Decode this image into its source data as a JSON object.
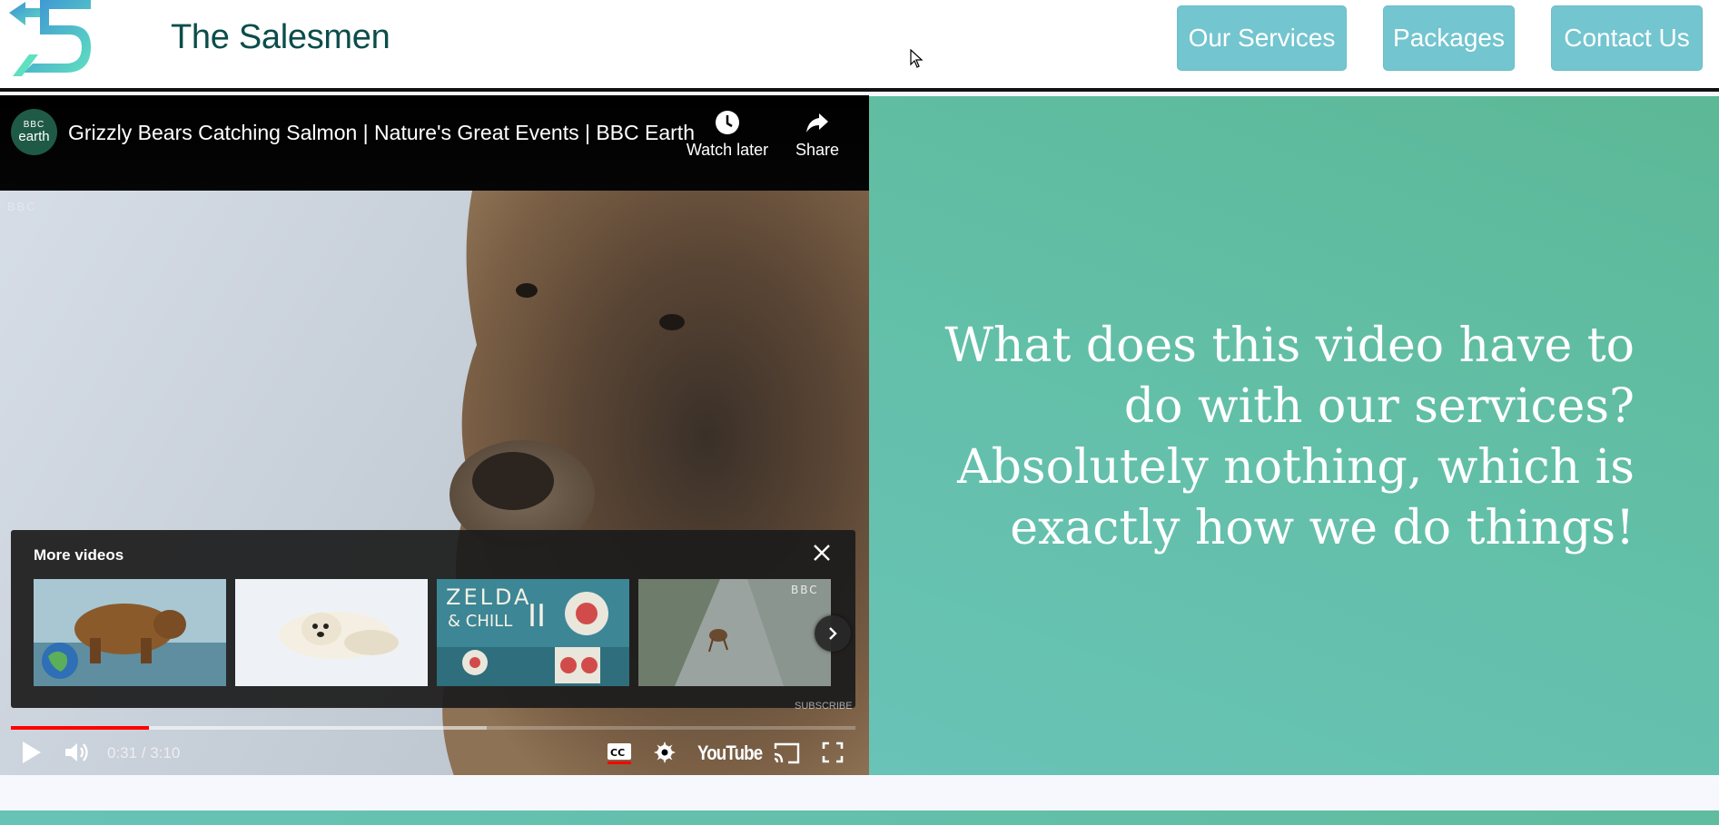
{
  "header": {
    "brand": "The Salesmen",
    "nav": [
      "Our Services",
      "Packages",
      "Contact Us"
    ]
  },
  "video": {
    "channel_avatar": {
      "top": "BBC",
      "bottom": "earth"
    },
    "title": "Grizzly Bears Catching Salmon | Nature's Great Events | BBC Earth",
    "watch_later_label": "Watch later",
    "share_label": "Share",
    "watermark": "BBC",
    "more_videos": {
      "title": "More videos",
      "thumbnails": [
        {
          "name": "brown-bear-thumbnail"
        },
        {
          "name": "polar-bear-thumbnail"
        },
        {
          "name": "zelda-and-chill-thumbnail",
          "text": "ZELDA & CHILL II"
        },
        {
          "name": "goat-on-dam-thumbnail",
          "badge": "BBC"
        }
      ]
    },
    "subscribe_watermark": "SUBSCRIBE",
    "progress": {
      "played": 0.163,
      "buffered": 0.563
    },
    "time": "0:31 / 3:10",
    "youtube_label": "YouTube"
  },
  "panel": {
    "lines": [
      "What does this video have to",
      "do with our services?",
      "Absolutely nothing, which is",
      "exactly how we do things!"
    ]
  },
  "colors": {
    "brand_text": "#0b4d4a",
    "nav_button": "#73c5cf",
    "panel_gradient_start": "#5cb896",
    "panel_gradient_end": "#69c3b7",
    "progress_played": "#ff0000"
  }
}
